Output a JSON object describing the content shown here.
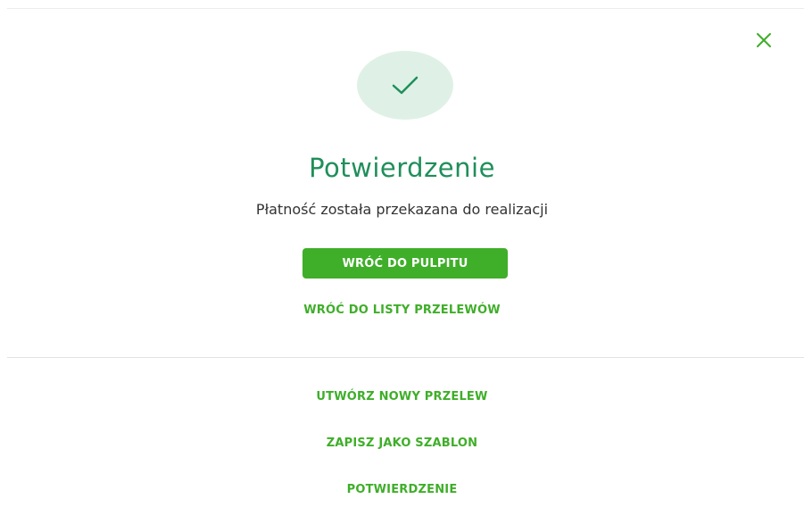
{
  "dialog": {
    "title": "Potwierdzenie",
    "message": "Płatność została przekazana do realizacji",
    "primary_button": "WRÓĆ DO PULPITU",
    "back_to_list_link": "WRÓĆ DO LISTY PRZELEWÓW"
  },
  "actions": {
    "new_transfer": "UTWÓRZ NOWY PRZELEW",
    "save_template": "ZAPISZ JAKO SZABLON",
    "confirmation": "POTWIERDZENIE"
  },
  "icons": {
    "close": "close-icon",
    "success": "checkmark-icon"
  },
  "colors": {
    "accent_green": "#3fae29",
    "title_green": "#1f8f5a",
    "success_circle": "#dff1e6"
  }
}
